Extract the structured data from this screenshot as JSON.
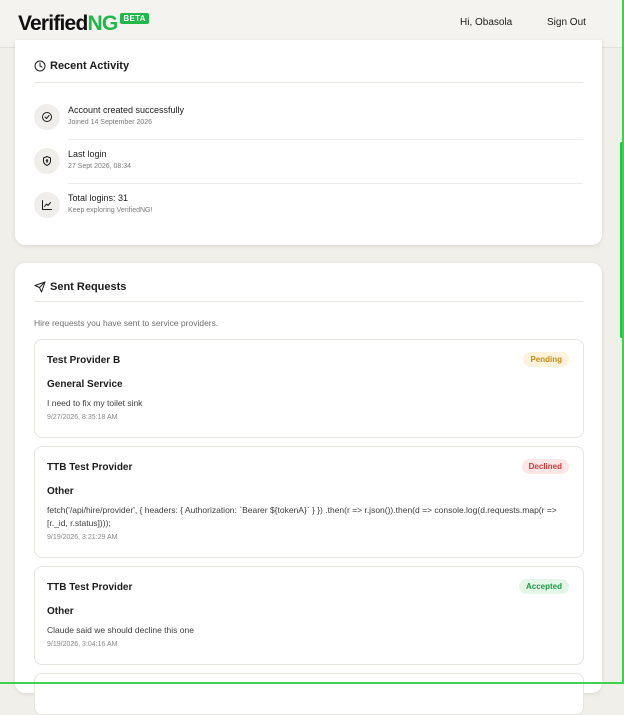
{
  "header": {
    "logo_verified": "Verified",
    "logo_ng": "NG",
    "beta": "BETA",
    "greeting": "Hi, Obasola",
    "sign_out": "Sign Out"
  },
  "recent_activity": {
    "title": "Recent Activity",
    "items": [
      {
        "icon": "check-circle-icon",
        "title": "Account created successfully",
        "subtitle": "Joined 14 September 2026"
      },
      {
        "icon": "shield-icon",
        "title": "Last login",
        "subtitle": "27 Sept 2026, 08:34"
      },
      {
        "icon": "trend-chart-icon",
        "title": "Total logins: 31",
        "subtitle": "Keep exploring VerifiedNG!"
      }
    ]
  },
  "sent_requests": {
    "title": "Sent Requests",
    "description": "Hire requests you have sent to service providers.",
    "items": [
      {
        "provider": "Test Provider B",
        "status": "Pending",
        "service": "General Service",
        "message": "I need to fix my toilet sink",
        "time": "9/27/2026, 8:35:18 AM"
      },
      {
        "provider": "TTB Test Provider",
        "status": "Declined",
        "service": "Other",
        "message": "fetch('/api/hire/provider', { headers: { Authorization: `Bearer ${tokenA}` } }) .then(r => r.json()).then(d => console.log(d.requests.map(r => [r._id, r.status])));",
        "time": "9/19/2026, 3:21:29 AM"
      },
      {
        "provider": "TTB Test Provider",
        "status": "Accepted",
        "service": "Other",
        "message": "Claude said we should decline this one",
        "time": "9/19/2026, 3:04:16 AM"
      }
    ]
  },
  "colors": {
    "brand_green": "#1fb84a",
    "pending_bg": "#fdf3dc",
    "pending_text": "#c98a12",
    "declined_bg": "#fde6e6",
    "declined_text": "#d43a3a",
    "accepted_bg": "#e3f6e8",
    "accepted_text": "#1f9a47"
  }
}
